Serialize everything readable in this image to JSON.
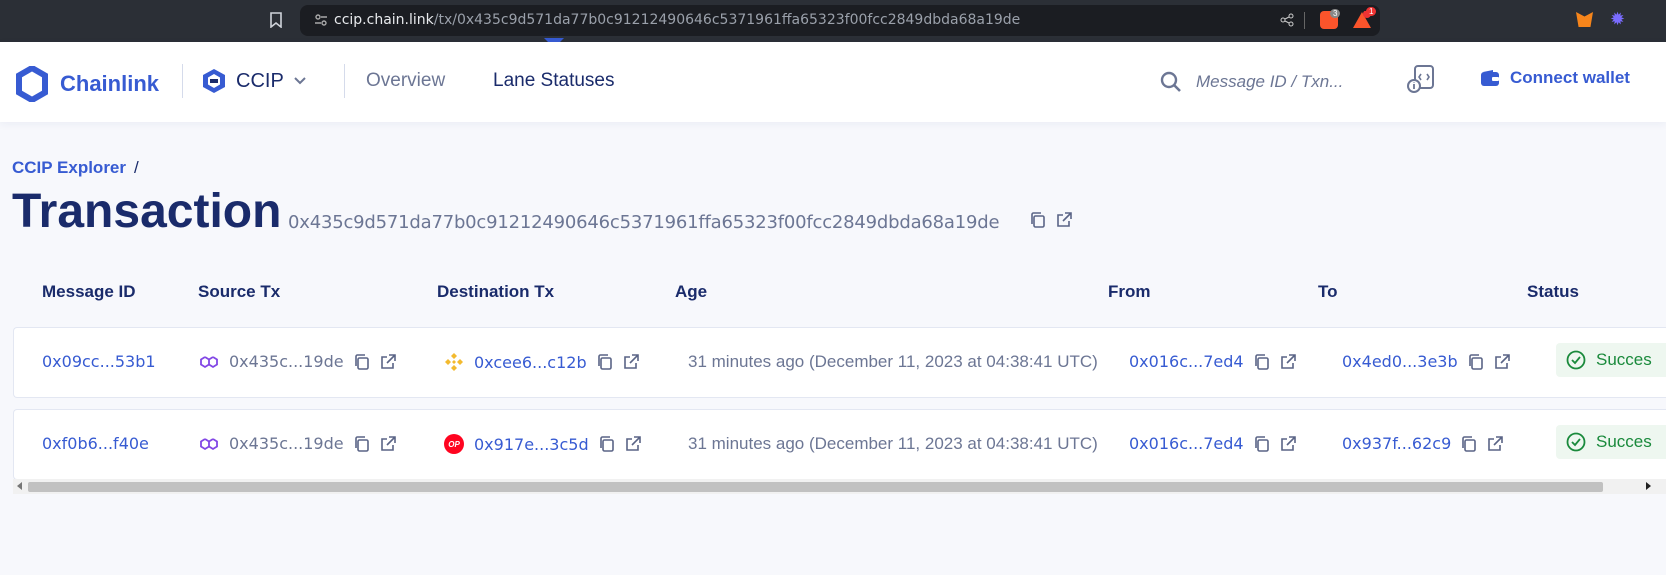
{
  "browser": {
    "url_host": "ccip.chain.link",
    "url_path": "/tx/0x435c9d571da77b0c91212490646c5371961ffa65323f00fcc2849dbda68a19de",
    "ext_badge_1": "3",
    "ext_badge_2": "1"
  },
  "header": {
    "brand": "Chainlink",
    "product": "CCIP",
    "nav": {
      "overview": "Overview",
      "lane_statuses": "Lane Statuses"
    },
    "search_placeholder": "Message ID / Txn...",
    "connect_wallet": "Connect wallet"
  },
  "breadcrumb": {
    "root": "CCIP Explorer",
    "separator": "/"
  },
  "page": {
    "title": "Transaction",
    "tx_hash": "0x435c9d571da77b0c91212490646c5371961ffa65323f00fcc2849dbda68a19de"
  },
  "table": {
    "columns": [
      "Message ID",
      "Source Tx",
      "Destination Tx",
      "Age",
      "From",
      "To",
      "Status"
    ],
    "rows": [
      {
        "message_id": "0x09cc...53b1",
        "source_tx": "0x435c...19de",
        "destination_tx": "0xcee6...c12b",
        "destination_chain_icon": "bnb-chain-icon",
        "age": "31 minutes ago (December 11, 2023 at 04:38:41 UTC)",
        "from": "0x016c...7ed4",
        "to": "0x4ed0...3e3b",
        "status": "Succes"
      },
      {
        "message_id": "0xf0b6...f40e",
        "source_tx": "0x435c...19de",
        "destination_tx": "0x917e...3c5d",
        "destination_chain_icon": "optimism-icon",
        "destination_chain_badge": "OP",
        "age": "31 minutes ago (December 11, 2023 at 04:38:41 UTC)",
        "from": "0x016c...7ed4",
        "to": "0x937f...62c9",
        "status": "Succes"
      }
    ]
  },
  "colors": {
    "brand_blue": "#375bd2",
    "navy": "#1a2b6b",
    "muted": "#6c7694",
    "success_green": "#1a8a3c",
    "polygon_purple": "#8247e5",
    "bnb_yellow": "#f3ba2f",
    "optimism_red": "#ff0420"
  }
}
